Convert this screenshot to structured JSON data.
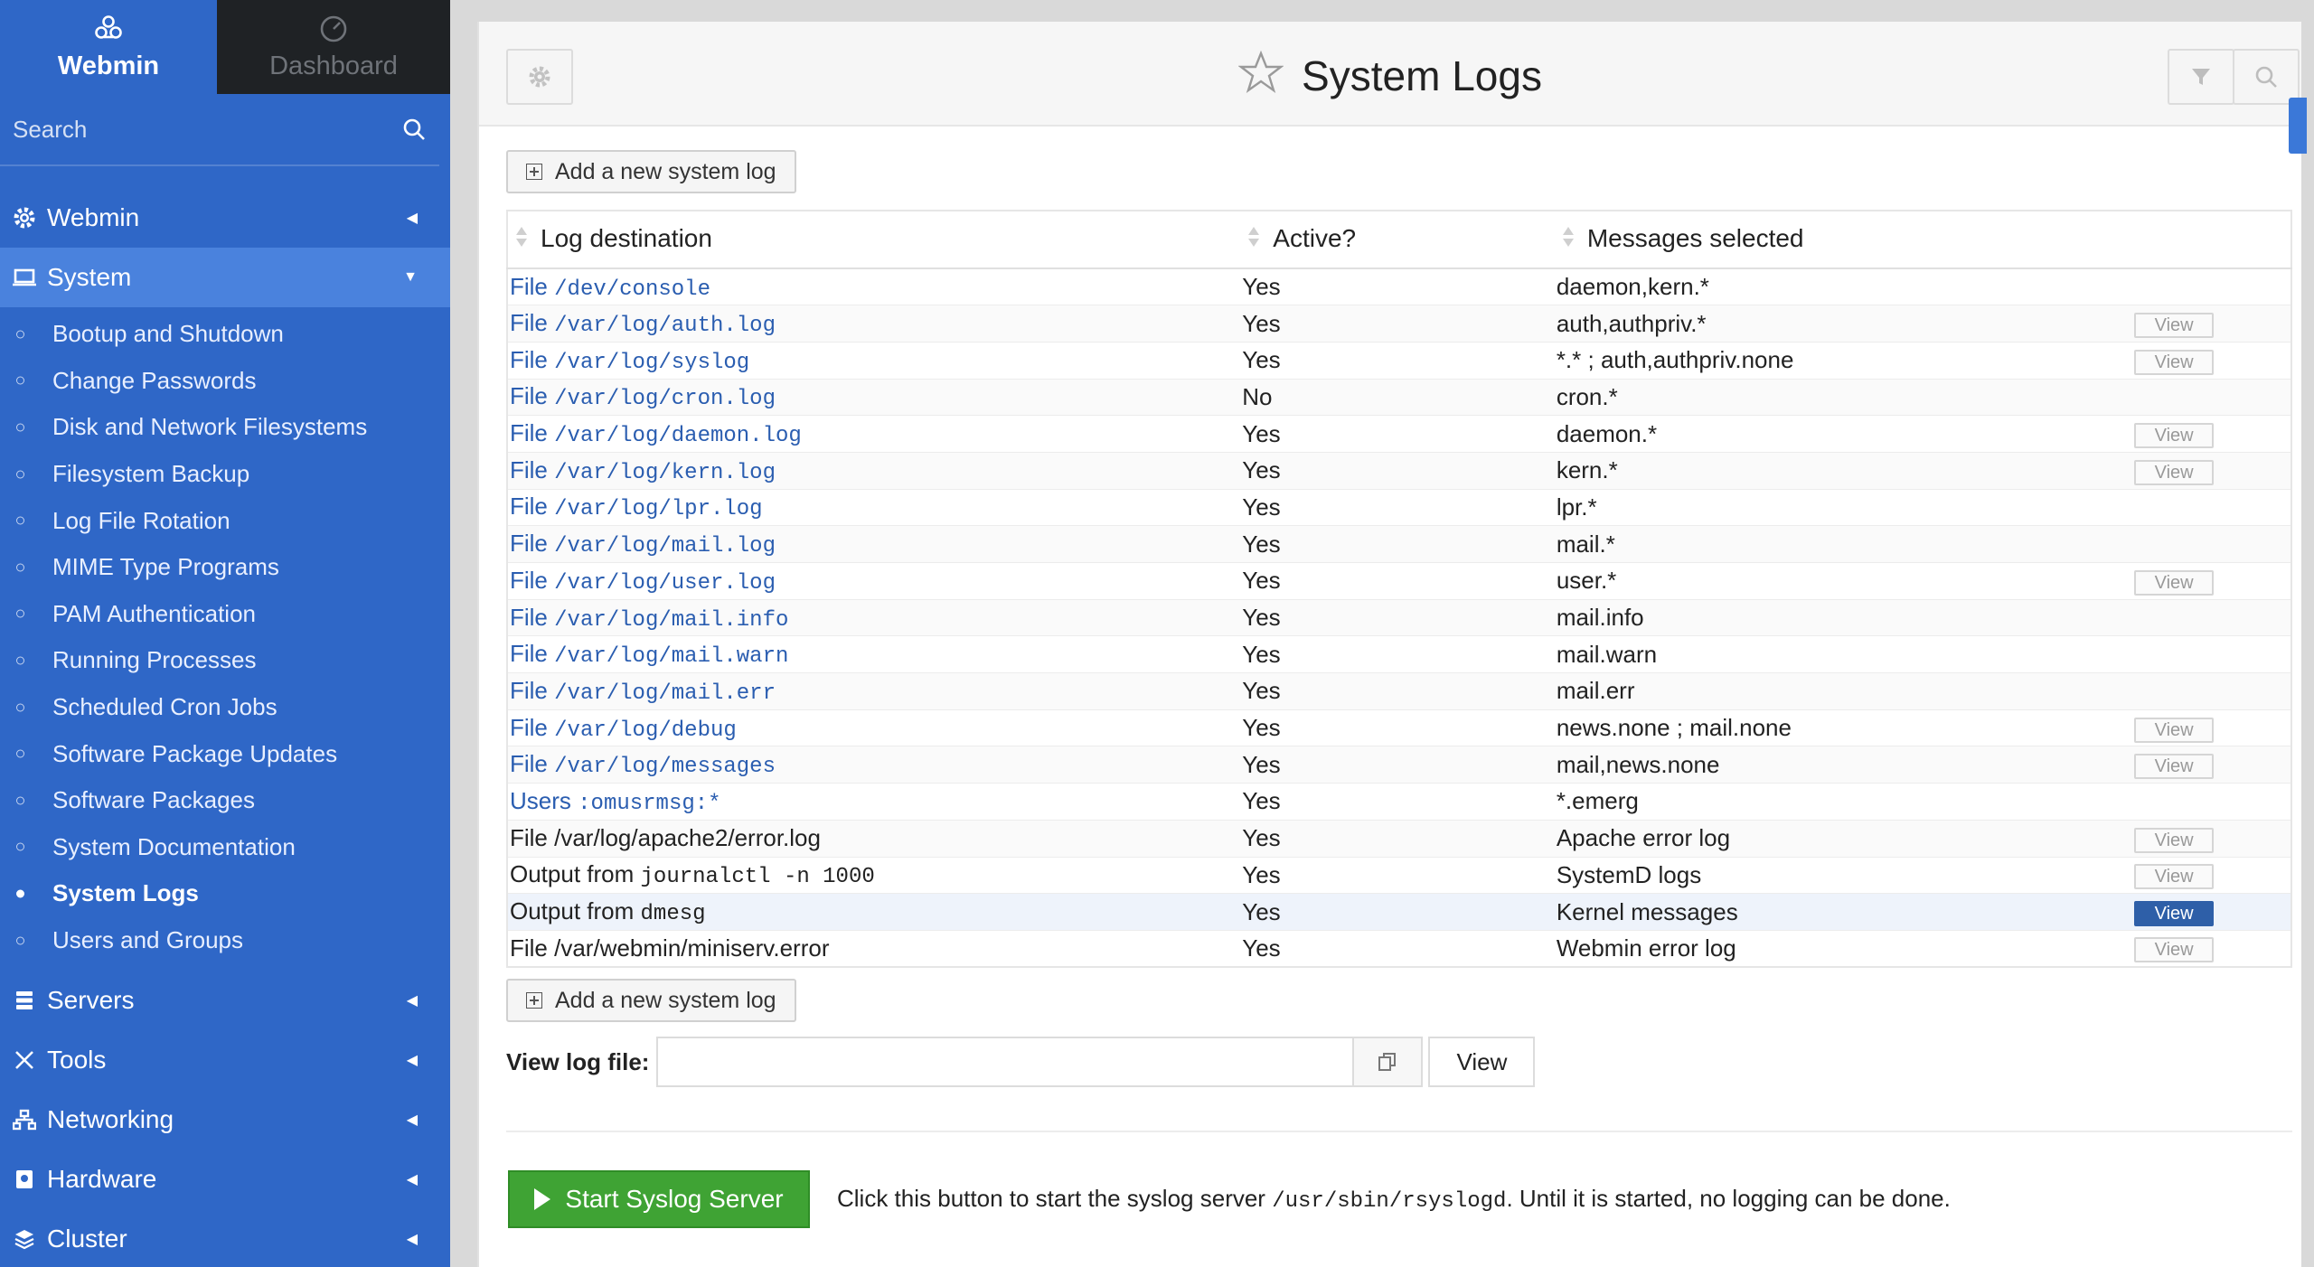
{
  "sidebar": {
    "brand": "Webmin",
    "dashboard": "Dashboard",
    "search_placeholder": "Search",
    "categories": {
      "webmin": "Webmin",
      "system": "System",
      "servers": "Servers",
      "tools": "Tools",
      "networking": "Networking",
      "hardware": "Hardware",
      "cluster": "Cluster"
    },
    "system_items": [
      "Bootup and Shutdown",
      "Change Passwords",
      "Disk and Network Filesystems",
      "Filesystem Backup",
      "Log File Rotation",
      "MIME Type Programs",
      "PAM Authentication",
      "Running Processes",
      "Scheduled Cron Jobs",
      "Software Package Updates",
      "Software Packages",
      "System Documentation",
      "System Logs",
      "Users and Groups"
    ]
  },
  "page": {
    "title": "System Logs",
    "add_button": "Add a new system log",
    "columns": {
      "destination": "Log destination",
      "active": "Active?",
      "messages": "Messages selected"
    },
    "rows": [
      {
        "prefix": "File",
        "path": "/dev/console",
        "active": "Yes",
        "messages": "daemon,kern.*",
        "view": ""
      },
      {
        "prefix": "File",
        "path": "/var/log/auth.log",
        "active": "Yes",
        "messages": "auth,authpriv.*",
        "view": "View"
      },
      {
        "prefix": "File",
        "path": "/var/log/syslog",
        "active": "Yes",
        "messages": "*.* ; auth,authpriv.none",
        "view": "View"
      },
      {
        "prefix": "File",
        "path": "/var/log/cron.log",
        "active": "No",
        "messages": "cron.*",
        "view": ""
      },
      {
        "prefix": "File",
        "path": "/var/log/daemon.log",
        "active": "Yes",
        "messages": "daemon.*",
        "view": "View"
      },
      {
        "prefix": "File",
        "path": "/var/log/kern.log",
        "active": "Yes",
        "messages": "kern.*",
        "view": "View"
      },
      {
        "prefix": "File",
        "path": "/var/log/lpr.log",
        "active": "Yes",
        "messages": "lpr.*",
        "view": ""
      },
      {
        "prefix": "File",
        "path": "/var/log/mail.log",
        "active": "Yes",
        "messages": "mail.*",
        "view": ""
      },
      {
        "prefix": "File",
        "path": "/var/log/user.log",
        "active": "Yes",
        "messages": "user.*",
        "view": "View"
      },
      {
        "prefix": "File",
        "path": "/var/log/mail.info",
        "active": "Yes",
        "messages": "mail.info",
        "view": ""
      },
      {
        "prefix": "File",
        "path": "/var/log/mail.warn",
        "active": "Yes",
        "messages": "mail.warn",
        "view": ""
      },
      {
        "prefix": "File",
        "path": "/var/log/mail.err",
        "active": "Yes",
        "messages": "mail.err",
        "view": ""
      },
      {
        "prefix": "File",
        "path": "/var/log/debug",
        "active": "Yes",
        "messages": "news.none ; mail.none",
        "view": "View"
      },
      {
        "prefix": "File",
        "path": "/var/log/messages",
        "active": "Yes",
        "messages": "mail,news.none",
        "view": "View"
      },
      {
        "prefix": "Users",
        "path": ":omusrmsg:*",
        "active": "Yes",
        "messages": "*.emerg",
        "view": ""
      }
    ],
    "extra_rows": [
      {
        "text": "File /var/log/apache2/error.log",
        "active": "Yes",
        "messages": "Apache error log",
        "view": "View"
      },
      {
        "prefix": "Output from",
        "cmd": "journalctl -n 1000",
        "active": "Yes",
        "messages": "SystemD logs",
        "view": "View"
      },
      {
        "prefix": "Output from",
        "cmd": "dmesg",
        "active": "Yes",
        "messages": "Kernel messages",
        "view": "View"
      },
      {
        "text": "File /var/webmin/miniserv.error",
        "active": "Yes",
        "messages": "Webmin error log",
        "view": "View"
      }
    ],
    "view_log_label": "View log file:",
    "view_log_value": "",
    "view_button": "View",
    "start_button": "Start Syslog Server",
    "note_before": "Click this button to start the syslog server",
    "note_path": "/usr/sbin/rsyslogd",
    "note_after": ". Until it is started, no logging can be done."
  },
  "colors": {
    "sidebar": "#2f67c7",
    "dashboard_tab": "#1f2225",
    "link": "#2a5db0",
    "inactive": "#d0312d",
    "start_button": "#3fa334",
    "primary_view": "#2e5fa8"
  },
  "icons": {
    "brand": "webmin-logo-icon",
    "dashboard": "speedometer-icon",
    "search": "search-icon",
    "settings": "gear-icon",
    "favorite": "star-icon",
    "filter": "filter-icon",
    "find": "search-icon"
  }
}
